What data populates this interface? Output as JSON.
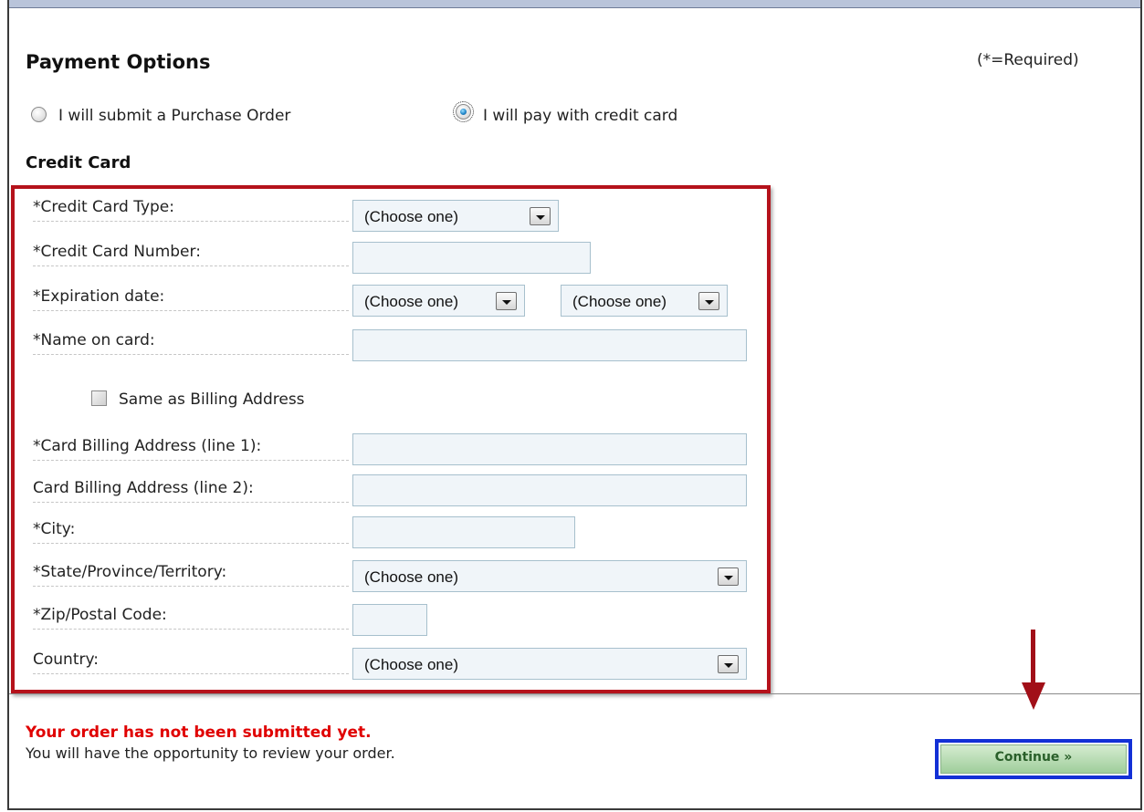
{
  "header": {
    "title": "Payment Options",
    "required_note": "(*=Required)"
  },
  "payment_method": {
    "options": [
      {
        "label": "I will submit a Purchase Order",
        "selected": false
      },
      {
        "label": "I will pay with credit card",
        "selected": true
      }
    ]
  },
  "credit_card": {
    "heading": "Credit Card",
    "fields": {
      "card_type": {
        "label": "*Credit Card Type:",
        "value": "(Choose one)"
      },
      "card_number": {
        "label": "*Credit Card Number:",
        "value": ""
      },
      "expiration": {
        "label": "*Expiration date:",
        "month_value": "(Choose one)",
        "year_value": "(Choose one)"
      },
      "name_on_card": {
        "label": "*Name on card:",
        "value": ""
      },
      "same_as_billing": {
        "label": "Same as Billing Address",
        "checked": false
      },
      "address1": {
        "label": "*Card Billing Address (line 1):",
        "value": ""
      },
      "address2": {
        "label": "Card Billing Address (line 2):",
        "value": ""
      },
      "city": {
        "label": "*City:",
        "value": ""
      },
      "state": {
        "label": "*State/Province/Territory:",
        "value": "(Choose one)"
      },
      "zip": {
        "label": "*Zip/Postal Code:",
        "value": ""
      },
      "country": {
        "label": "Country:",
        "value": "(Choose one)"
      }
    }
  },
  "footer": {
    "warning": "Your order has not been submitted yet.",
    "note": "You will have the opportunity to review your order.",
    "continue_label": "Continue »"
  },
  "colors": {
    "highlight_form": "#b5121b",
    "highlight_button": "#1330d6",
    "warning_text": "#e00000"
  },
  "icons": [
    "radio-icon",
    "dropdown-arrow-icon",
    "checkbox-icon",
    "pointer-arrow-icon"
  ]
}
